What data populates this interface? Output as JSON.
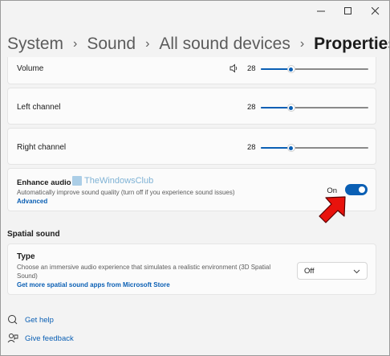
{
  "window": {
    "controls": [
      "minimize-icon",
      "maximize-icon",
      "close-icon"
    ]
  },
  "breadcrumb": {
    "items": [
      "System",
      "Sound",
      "All sound devices"
    ],
    "current": "Properties",
    "separator": "›"
  },
  "levels": {
    "volume": {
      "label": "Volume",
      "value": "28",
      "fraction": 0.28,
      "icon": "speaker-icon"
    },
    "left": {
      "label": "Left channel",
      "value": "28",
      "fraction": 0.28
    },
    "right": {
      "label": "Right channel",
      "value": "28",
      "fraction": 0.28
    }
  },
  "enhance": {
    "title": "Enhance audio",
    "description": "Automatically improve sound quality (turn off if you experience sound issues)",
    "link": "Advanced",
    "toggle_label": "On",
    "toggle_on": true,
    "watermark": "TheWindowsClub"
  },
  "spatial": {
    "section_title": "Spatial sound",
    "type_title": "Type",
    "type_description": "Choose an immersive audio experience that simulates a realistic environment (3D Spatial Sound)",
    "type_link": "Get more spatial sound apps from Microsoft Store",
    "dropdown_value": "Off"
  },
  "footer": {
    "help": "Get help",
    "feedback": "Give feedback"
  },
  "colors": {
    "accent": "#0a5fb4",
    "arrow": "#e8120c"
  }
}
